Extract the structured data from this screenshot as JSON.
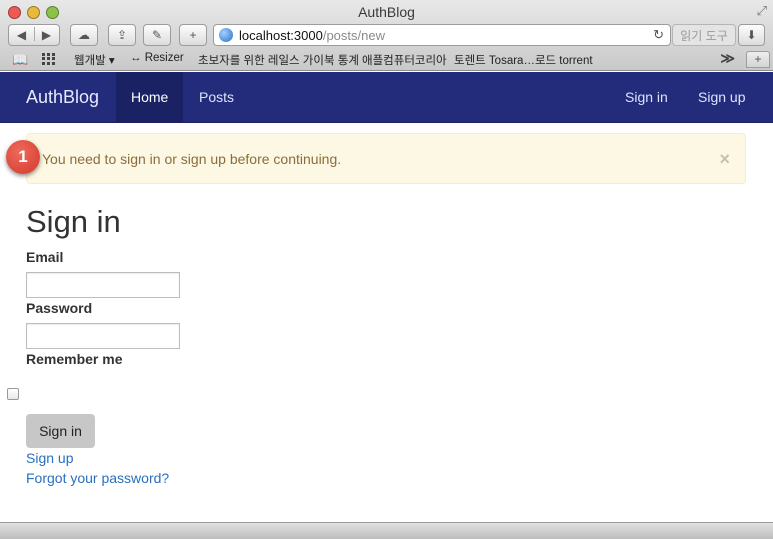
{
  "window": {
    "title": "AuthBlog"
  },
  "toolbar": {
    "back_icon": "back-arrow-icon",
    "forward_icon": "forward-arrow-icon",
    "url_host": "localhost:3000",
    "url_path": "/posts/new",
    "reader_label": "읽기 도구"
  },
  "bookmarks": {
    "items": [
      "웹개발 ▾",
      "↔ Resizer",
      "초보자를 위한 레일스 가이북 통계",
      "애플컴퓨터코리아",
      "토렌트 Tosara…로드 torrent"
    ],
    "more": "≫",
    "new_tab": "+"
  },
  "navbar": {
    "brand": "AuthBlog",
    "links": [
      "Home",
      "Posts"
    ],
    "right_links": [
      "Sign in",
      "Sign up"
    ],
    "background": "#222c7a"
  },
  "alert": {
    "message": "You need to sign in or sign up before continuing.",
    "close": "×"
  },
  "annotation": {
    "number": "1"
  },
  "form": {
    "title": "Sign in",
    "email_label": "Email",
    "email_value": "",
    "password_label": "Password",
    "password_value": "",
    "remember_label": "Remember me",
    "remember_checked": false,
    "submit_label": "Sign in"
  },
  "links": {
    "sign_up": "Sign up",
    "forgot": "Forgot your password?"
  }
}
